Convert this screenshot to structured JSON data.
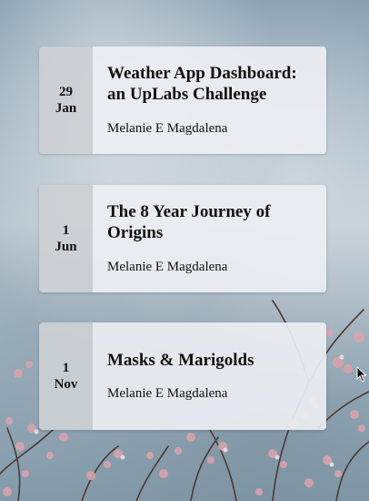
{
  "posts": [
    {
      "day": "29",
      "month": "Jan",
      "title": "Weather App Dashboard: an UpLabs Challenge",
      "author": "Melanie E Magdalena"
    },
    {
      "day": "1",
      "month": "Jun",
      "title": "The 8 Year Journey of Origins",
      "author": "Melanie E Magdalena"
    },
    {
      "day": "1",
      "month": "Nov",
      "title": "Masks & Marigolds",
      "author": "Melanie E Magdalena"
    }
  ],
  "icons": {
    "cursor": "mouse-cursor-icon"
  }
}
